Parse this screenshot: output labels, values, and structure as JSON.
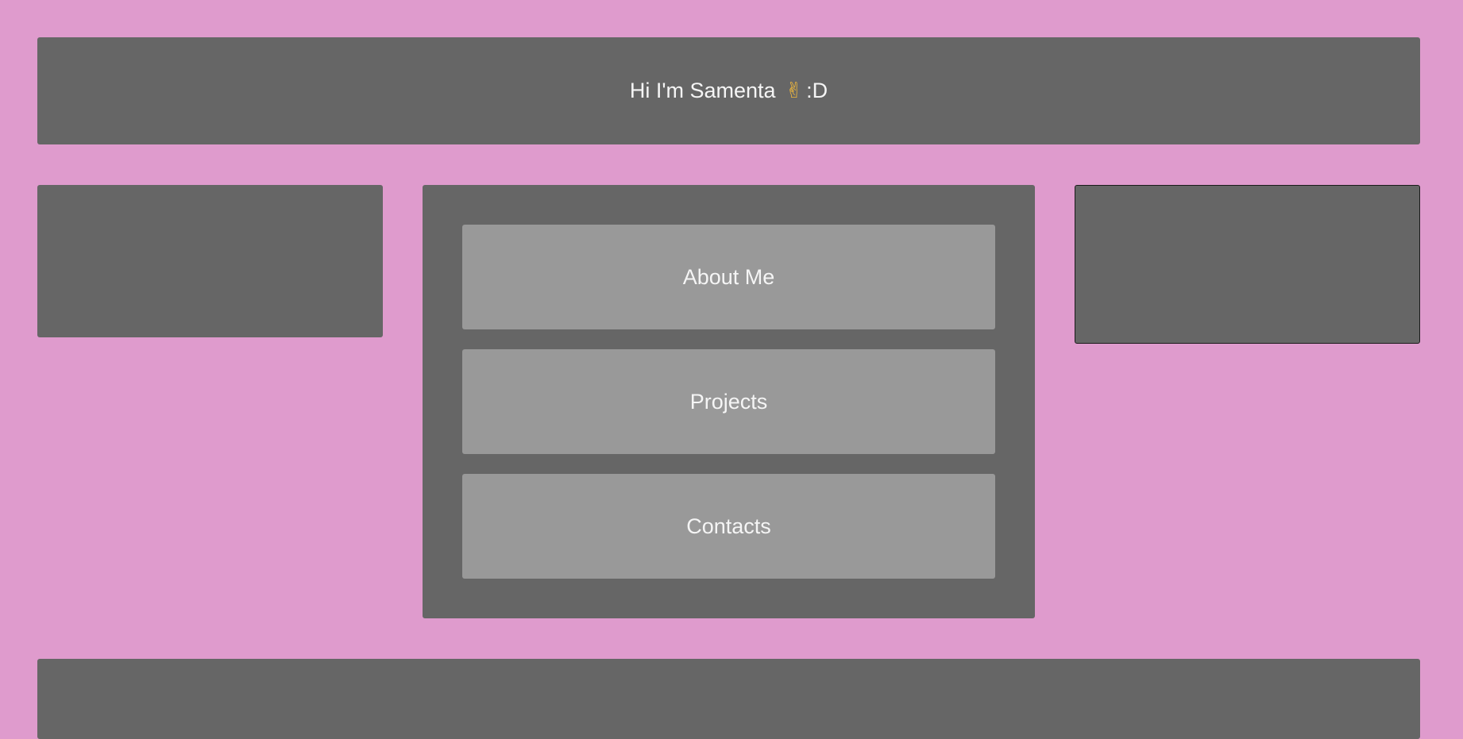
{
  "theme": {
    "page_background": "#df9bcd",
    "panel_color": "#666666",
    "button_color": "#999999",
    "text_color": "#f5f5f5"
  },
  "header": {
    "greeting": "Hi I'm Samenta",
    "emoji": "✌",
    "suffix": ":D"
  },
  "nav": {
    "items": [
      {
        "label": "About Me"
      },
      {
        "label": "Projects"
      },
      {
        "label": "Contacts"
      }
    ]
  }
}
